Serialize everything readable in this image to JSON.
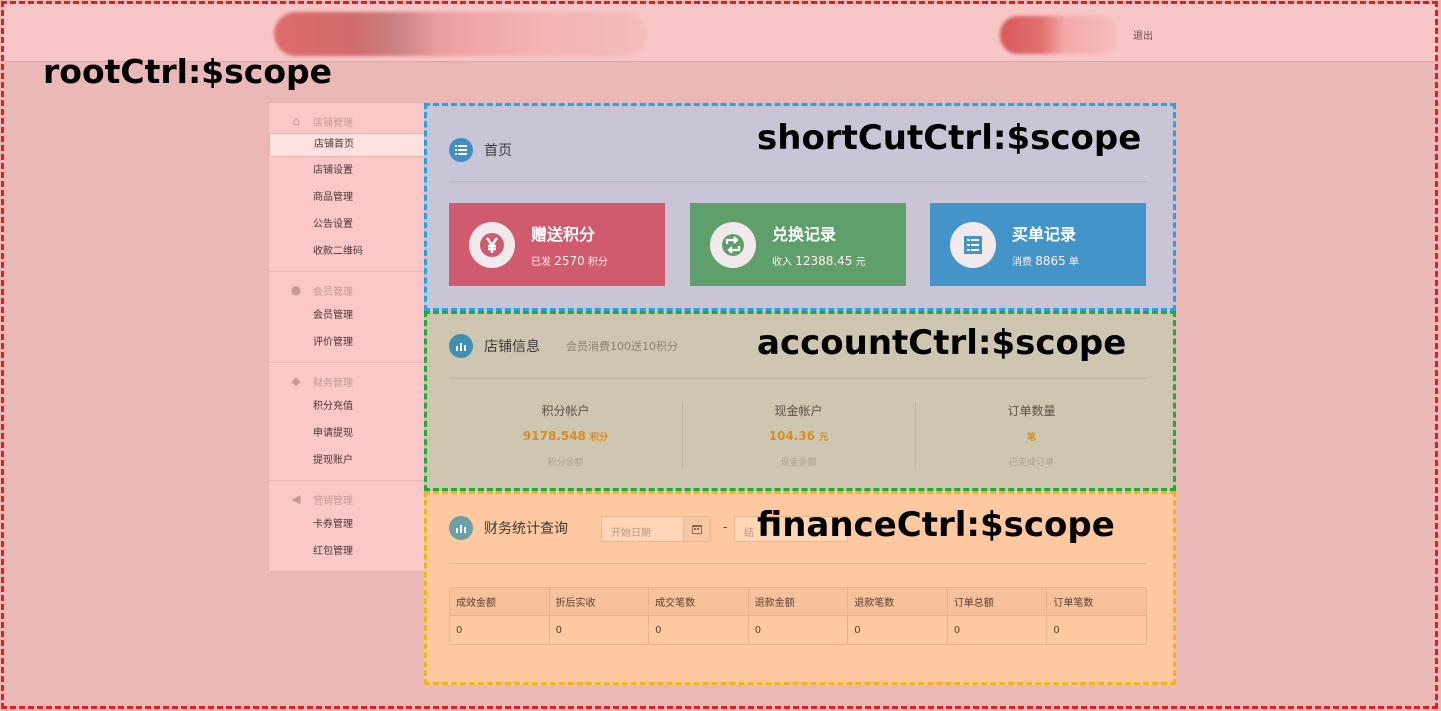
{
  "scope_labels": {
    "root": "rootCtrl:$scope",
    "shortcut": "shortCutCtrl:$scope",
    "account": "accountCtrl:$scope",
    "finance": "financeCtrl:$scope"
  },
  "topbar": {
    "logout_label": "退出"
  },
  "sidebar": {
    "groups": [
      {
        "title": "店铺管理",
        "icon": "home-icon",
        "items": [
          "店铺首页",
          "店铺设置",
          "商品管理",
          "公告设置",
          "收款二维码"
        ]
      },
      {
        "title": "会员管理",
        "icon": "user-icon",
        "items": [
          "会员管理",
          "评价管理"
        ]
      },
      {
        "title": "财务管理",
        "icon": "piggy-bank-icon",
        "items": [
          "积分充值",
          "申请提现",
          "提现账户"
        ]
      },
      {
        "title": "营销管理",
        "icon": "bullhorn-icon",
        "items": [
          "卡券管理",
          "红包管理"
        ]
      }
    ]
  },
  "shortcut": {
    "title": "首页",
    "cards": [
      {
        "title": "赠送积分",
        "prefix": "已发",
        "value": "2570",
        "unit": "积分",
        "icon": "yen-icon",
        "color": "#d05a6e"
      },
      {
        "title": "兑换记录",
        "prefix": "收入",
        "value": "12388.45",
        "unit": "元",
        "icon": "retweet-icon",
        "color": "#5f9f6c"
      },
      {
        "title": "买单记录",
        "prefix": "消费",
        "value": "8865",
        "unit": "单",
        "icon": "list-alt-icon",
        "color": "#4394c9"
      }
    ]
  },
  "account": {
    "title": "店铺信息",
    "subtitle": "会员消费100送10积分",
    "stats": [
      {
        "label": "积分帐户",
        "value": "9178.548",
        "unit": "积分",
        "note": "积分余额"
      },
      {
        "label": "现金帐户",
        "value": "104.36",
        "unit": "元",
        "note": "现金余额"
      },
      {
        "label": "订单数量",
        "value": "",
        "unit": "笔",
        "note": "已完成订单"
      }
    ]
  },
  "finance": {
    "title": "财务统计查询",
    "start_placeholder": "开始日期",
    "separator": "-",
    "end_placeholder": "结",
    "columns": [
      "成效金额",
      "折后实收",
      "成交笔数",
      "退款金额",
      "退款笔数",
      "订单总额",
      "订单笔数"
    ],
    "row": [
      "0",
      "0",
      "0",
      "0",
      "0",
      "0",
      "0"
    ]
  }
}
